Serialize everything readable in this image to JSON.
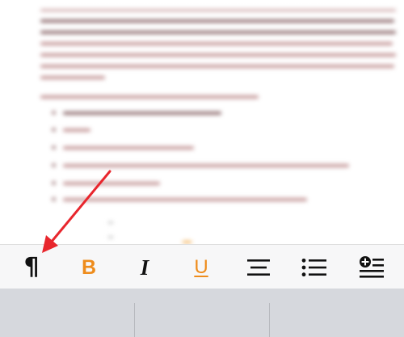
{
  "toolbar": {
    "paragraph_glyph": "¶",
    "bold_glyph": "B",
    "italic_glyph": "I",
    "underline_glyph": "U"
  },
  "colors": {
    "accent": "#ee8c1c",
    "icon": "#111111",
    "annotation_arrow": "#e8262d"
  },
  "icons": {
    "paragraph": "paragraph-icon",
    "bold": "bold-icon",
    "italic": "italic-icon",
    "underline": "underline-icon",
    "align": "align-center-icon",
    "list": "bullet-list-icon",
    "insert": "insert-plus-icon"
  }
}
